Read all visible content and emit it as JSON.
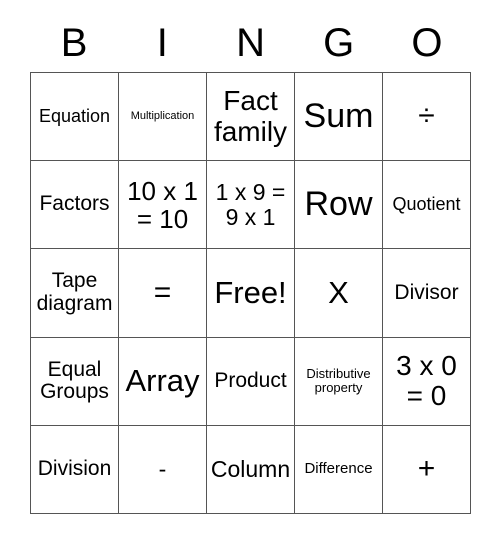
{
  "card": {
    "title_letters": [
      "B",
      "I",
      "N",
      "G",
      "O"
    ],
    "border_color": "#555555",
    "text_color": "#000000",
    "background_color": "#ffffff",
    "rows": 5,
    "columns": 5,
    "free_space": "Free!",
    "cells": [
      [
        {
          "text": "Equation",
          "size": "fs-md"
        },
        {
          "text": "Multiplication",
          "size": "fs-xs"
        },
        {
          "text": "Fact\nfamily",
          "size": "fs-3xl"
        },
        {
          "text": "Sum",
          "size": "fs-5xl"
        },
        {
          "text": "÷",
          "size": "fs-sym"
        }
      ],
      [
        {
          "text": "Factors",
          "size": "fs-lg"
        },
        {
          "text": "10 x 1\n= 10",
          "size": "fs-2xl"
        },
        {
          "text": "1 x 9 =\n9 x 1",
          "size": "fs-xl"
        },
        {
          "text": "Row",
          "size": "fs-5xl"
        },
        {
          "text": "Quotient",
          "size": "fs-md"
        }
      ],
      [
        {
          "text": "Tape\ndiagram",
          "size": "fs-lg"
        },
        {
          "text": "=",
          "size": "fs-sym"
        },
        {
          "text": "Free!",
          "size": "fs-4xl"
        },
        {
          "text": "X",
          "size": "fs-4xl"
        },
        {
          "text": "Divisor",
          "size": "fs-lg"
        }
      ],
      [
        {
          "text": "Equal\nGroups",
          "size": "fs-lg"
        },
        {
          "text": "Array",
          "size": "fs-4xl"
        },
        {
          "text": "Product",
          "size": "fs-lg"
        },
        {
          "text": "Distributive\nproperty",
          "size": "fs-sm"
        },
        {
          "text": "3 x 0\n= 0",
          "size": "fs-3xl"
        }
      ],
      [
        {
          "text": "Division",
          "size": "fs-lg"
        },
        {
          "text": "-",
          "size": "fs-xl"
        },
        {
          "text": "Column",
          "size": "fs-xl"
        },
        {
          "text": "Difference",
          "size": "fs-smd"
        },
        {
          "text": "+",
          "size": "fs-sym"
        }
      ]
    ]
  }
}
